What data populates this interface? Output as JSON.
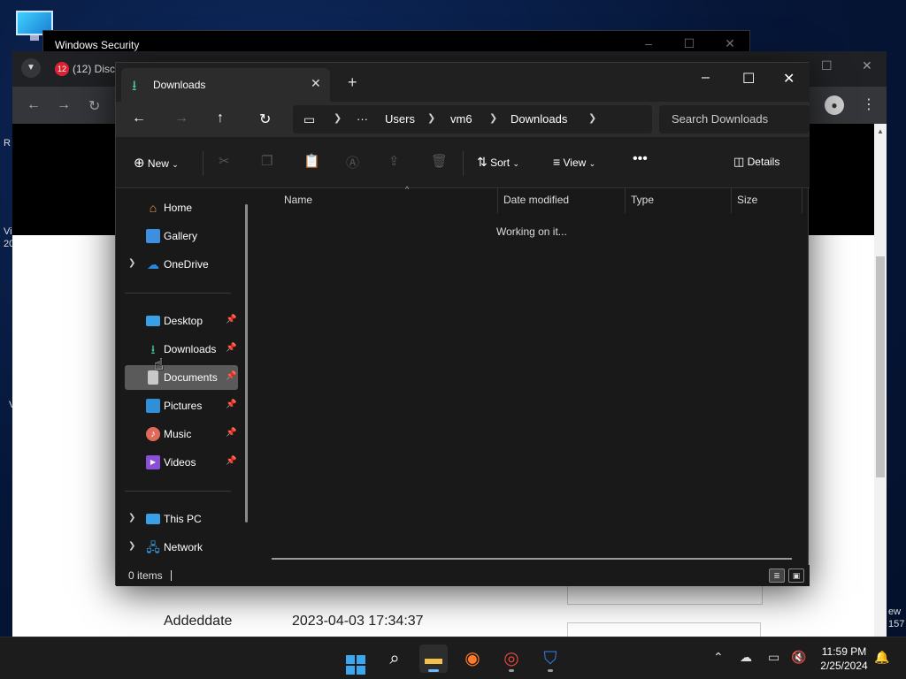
{
  "desktop": {
    "left_text_1": "R",
    "left_text_2": "Vi",
    "left_text_3": "20",
    "left_text_4": "V",
    "right_text_1": "ew",
    "right_text_2": "157"
  },
  "win_security": {
    "title": "Windows Security"
  },
  "browser": {
    "tab_title": "(12) Disc",
    "tab_badge": "12",
    "page_row_label": "Addeddate",
    "page_row_value": "2023-04-03 17:34:37"
  },
  "explorer": {
    "tab_title": "Downloads",
    "breadcrumbs": [
      "Users",
      "vm6",
      "Downloads"
    ],
    "search_placeholder": "Search Downloads",
    "commands": {
      "new": "New",
      "sort": "Sort",
      "view": "View",
      "details": "Details"
    },
    "nav_items": [
      {
        "label": "Home",
        "icon": "home-icon",
        "color": "#e8a04a"
      },
      {
        "label": "Gallery",
        "icon": "gallery-icon",
        "color": "#3d8fe0"
      },
      {
        "label": "OneDrive",
        "icon": "cloud-icon",
        "color": "#2b88d8"
      },
      {
        "label": "Desktop",
        "icon": "desktop-icon",
        "color": "#3aa0e6"
      },
      {
        "label": "Downloads",
        "icon": "download-icon",
        "color": "#4cc2a0"
      },
      {
        "label": "Documents",
        "icon": "document-icon",
        "color": "#c8c8c8"
      },
      {
        "label": "Pictures",
        "icon": "pictures-icon",
        "color": "#2f8fd8"
      },
      {
        "label": "Music",
        "icon": "music-icon",
        "color": "#e06a5a"
      },
      {
        "label": "Videos",
        "icon": "videos-icon",
        "color": "#8a4fd8"
      },
      {
        "label": "This PC",
        "icon": "computer-icon",
        "color": "#3aa0e6"
      },
      {
        "label": "Network",
        "icon": "network-icon",
        "color": "#3aa0e6"
      }
    ],
    "columns": [
      "Name",
      "Date modified",
      "Type",
      "Size"
    ],
    "working_text": "Working on it...",
    "status_count": "0 items"
  },
  "taskbar": {
    "time": "11:59 PM",
    "date": "2/25/2024"
  }
}
